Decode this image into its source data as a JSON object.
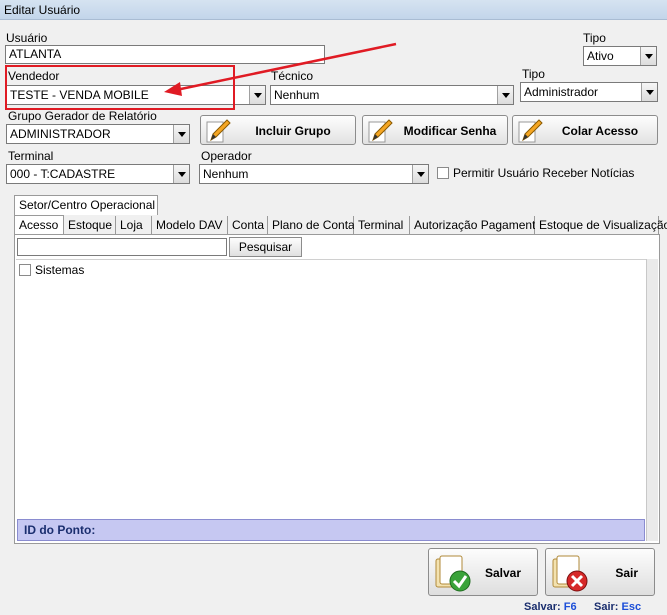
{
  "window": {
    "title": "Editar Usuário"
  },
  "usuario": {
    "label": "Usuário",
    "value": "ATLANTA"
  },
  "tipo_top": {
    "label": "Tipo",
    "value": "Ativo"
  },
  "vendedor": {
    "label": "Vendedor",
    "value": "TESTE - VENDA MOBILE"
  },
  "tecnico": {
    "label": "Técnico",
    "value": "Nenhum"
  },
  "tipo_user": {
    "label": "Tipo",
    "value": "Administrador"
  },
  "grupo": {
    "label": "Grupo Gerador de Relatório",
    "value": "ADMINISTRADOR"
  },
  "buttons": {
    "incluir_grupo": "Incluir Grupo",
    "modificar_senha": "Modificar Senha",
    "colar_acesso": "Colar Acesso"
  },
  "terminal": {
    "label": "Terminal",
    "value": "000 - T:CADASTRE"
  },
  "operador": {
    "label": "Operador",
    "value": "Nenhum"
  },
  "permitir": {
    "label": "Permitir Usuário Receber Notícias"
  },
  "setor_tab": "Setor/Centro Operacional",
  "tabs": [
    "Acesso",
    "Estoque",
    "Loja",
    "Modelo DAV",
    "Conta",
    "Plano de Conta",
    "Terminal",
    "Autorização Pagamento",
    "Estoque de Visualização"
  ],
  "search": {
    "button": "Pesquisar",
    "value": ""
  },
  "tree": {
    "item": "Sistemas"
  },
  "id_ponto": "ID do Ponto:",
  "footer": {
    "salvar": "Salvar",
    "sair": "Sair",
    "salvar_key_label": "Salvar:",
    "salvar_key": "F6",
    "sair_key_label": "Sair:",
    "sair_key": "Esc"
  },
  "colors": {
    "highlight": "#e01b24",
    "idbar": "#c6c8f2"
  }
}
